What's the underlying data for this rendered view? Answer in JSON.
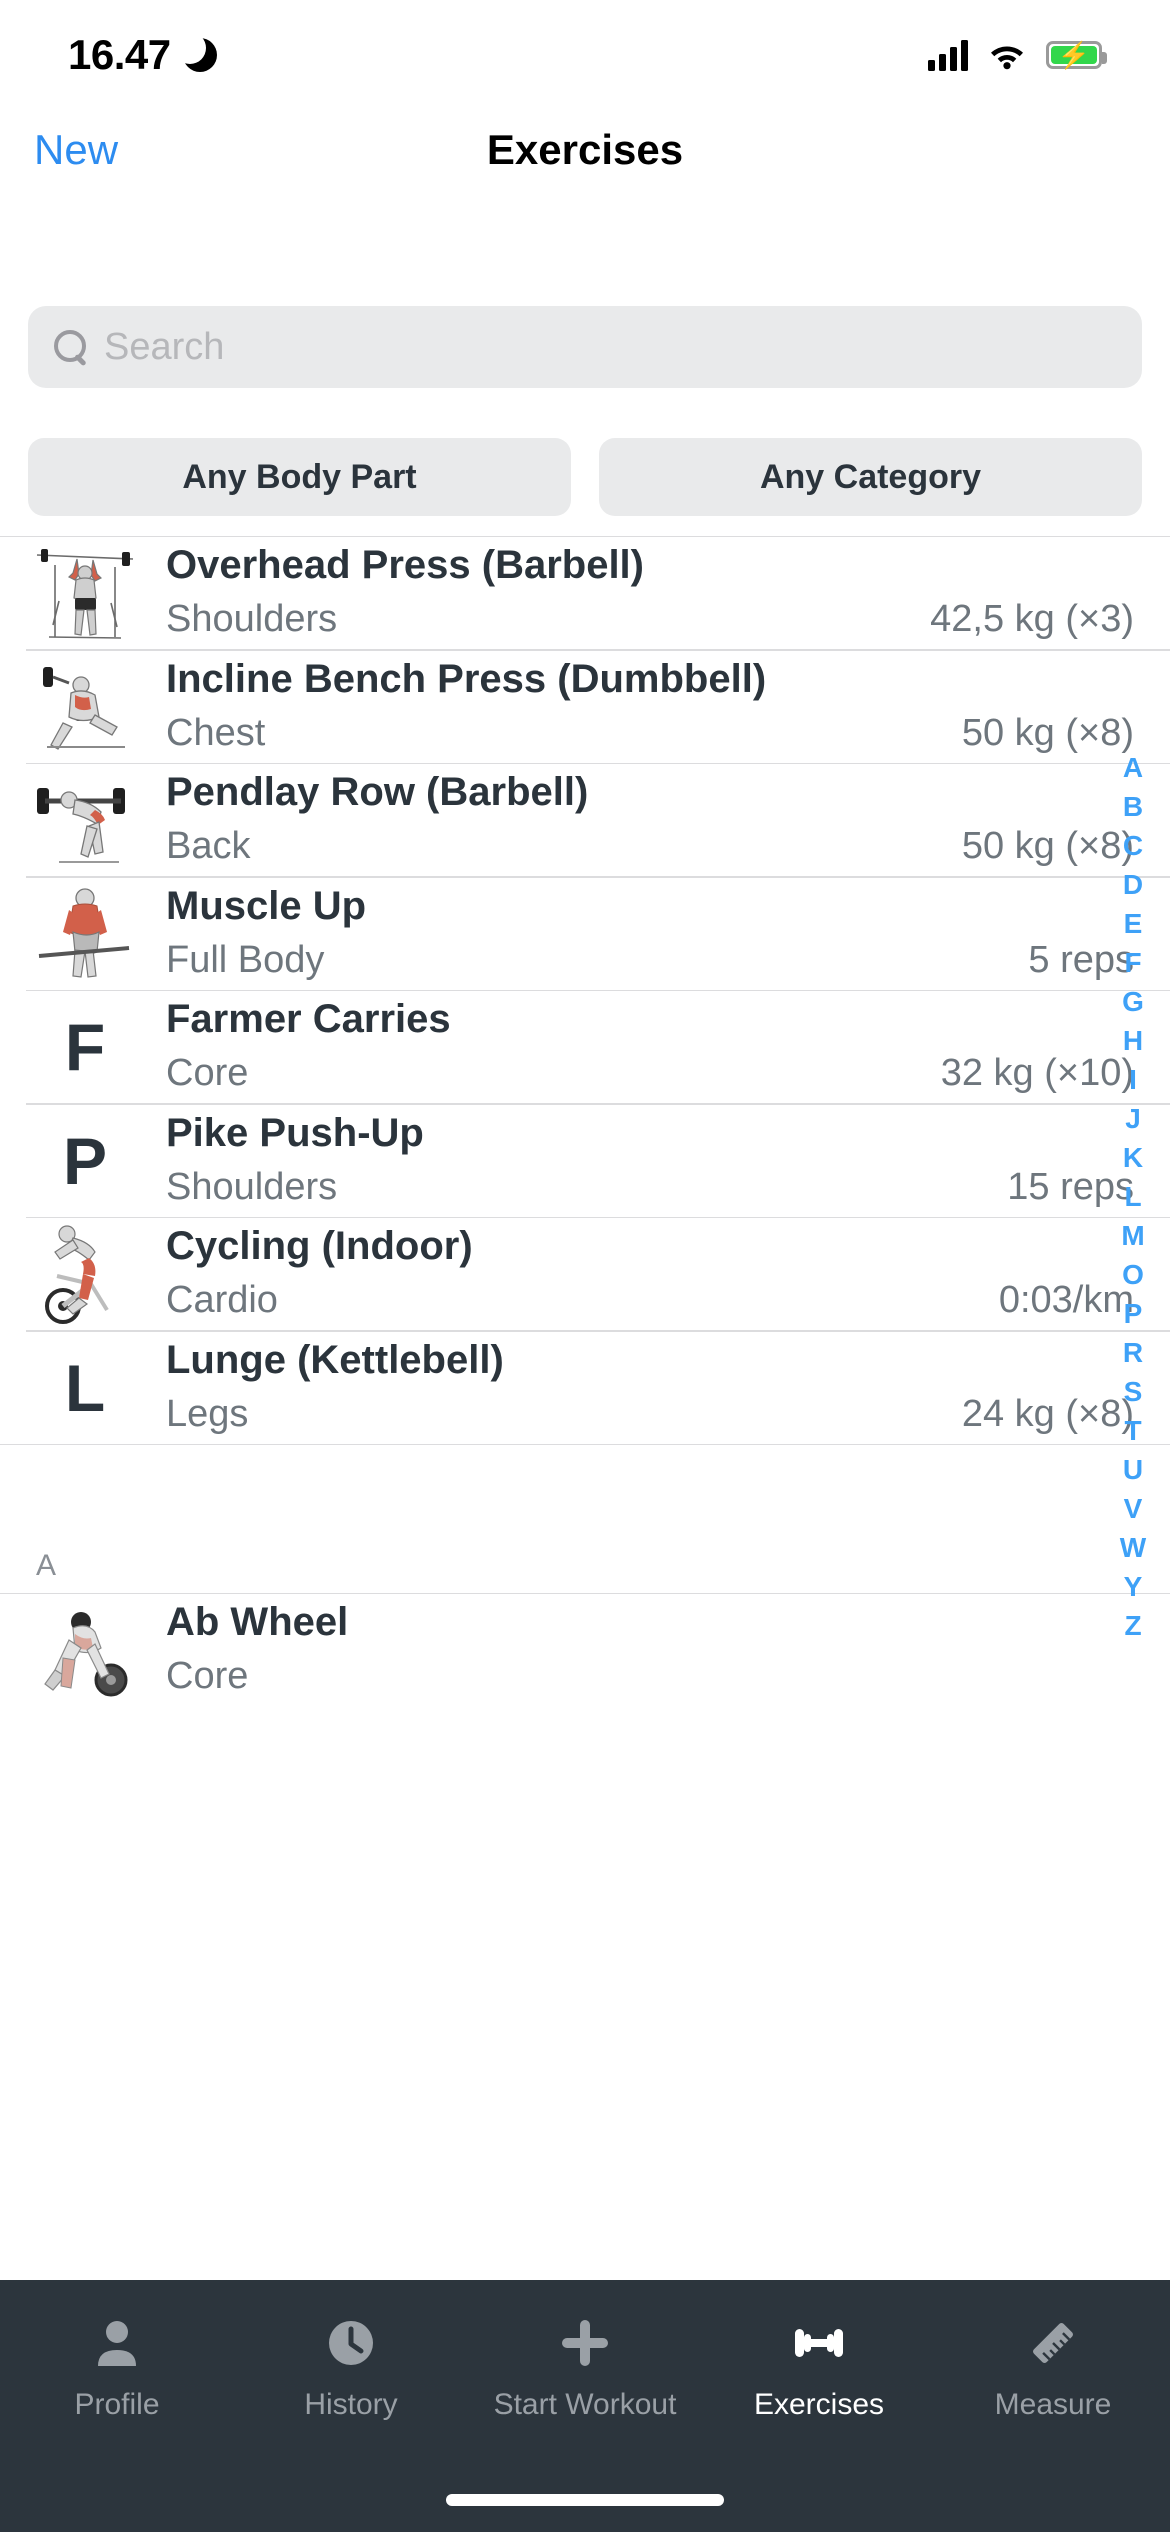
{
  "status_bar": {
    "time": "16.47",
    "dnd_icon": "crescent-moon-icon",
    "signal_icon": "cellular-signal-icon",
    "wifi_icon": "wifi-icon",
    "battery_icon": "battery-charging-icon"
  },
  "nav": {
    "left_action": "New",
    "title": "Exercises"
  },
  "search": {
    "placeholder": "Search",
    "value": "",
    "icon": "search-icon"
  },
  "filters": [
    {
      "label": "Any Body Part"
    },
    {
      "label": "Any Category"
    }
  ],
  "list": [
    {
      "name": "Overhead Press (Barbell)",
      "group": "Shoulders",
      "value": "42,5 kg (×3)",
      "thumb": "figure-overhead-press",
      "letter": ""
    },
    {
      "name": "Incline Bench Press (Dumbbell)",
      "group": "Chest",
      "value": "50 kg (×8)",
      "thumb": "figure-incline-bench-press",
      "letter": ""
    },
    {
      "name": "Pendlay Row (Barbell)",
      "group": "Back",
      "value": "50 kg (×8)",
      "thumb": "figure-pendlay-row",
      "letter": ""
    },
    {
      "name": "Muscle Up",
      "group": "Full Body",
      "value": "5 reps",
      "thumb": "figure-muscle-up",
      "letter": ""
    },
    {
      "name": "Farmer Carries",
      "group": "Core",
      "value": "32 kg (×10)",
      "thumb": "",
      "letter": "F"
    },
    {
      "name": "Pike Push-Up",
      "group": "Shoulders",
      "value": "15 reps",
      "thumb": "",
      "letter": "P"
    },
    {
      "name": "Cycling (Indoor)",
      "group": "Cardio",
      "value": "0:03/km",
      "thumb": "figure-cycling-indoor",
      "letter": ""
    },
    {
      "name": "Lunge (Kettlebell)",
      "group": "Legs",
      "value": "24 kg (×8)",
      "thumb": "",
      "letter": "L"
    }
  ],
  "section": {
    "header": "A",
    "items": [
      {
        "name": "Ab Wheel",
        "group": "Core",
        "value": "",
        "thumb": "figure-ab-wheel",
        "letter": ""
      }
    ]
  },
  "alphabet_index": [
    "A",
    "B",
    "C",
    "D",
    "E",
    "F",
    "G",
    "H",
    "I",
    "J",
    "K",
    "L",
    "M",
    "O",
    "P",
    "R",
    "S",
    "T",
    "U",
    "V",
    "W",
    "Y",
    "Z"
  ],
  "tabbar": [
    {
      "label": "Profile",
      "icon": "person-icon",
      "active": false
    },
    {
      "label": "History",
      "icon": "clock-icon",
      "active": false
    },
    {
      "label": "Start Workout",
      "icon": "plus-icon",
      "active": false
    },
    {
      "label": "Exercises",
      "icon": "dumbbell-icon",
      "active": true
    },
    {
      "label": "Measure",
      "icon": "ruler-icon",
      "active": false
    }
  ],
  "colors": {
    "accent": "#2d8cf0",
    "index_blue": "#3ea1f7",
    "tabbar_bg": "#2c353d",
    "text_primary": "#2b343c",
    "text_secondary": "#6e767d",
    "field_bg": "#e9eaeb"
  }
}
